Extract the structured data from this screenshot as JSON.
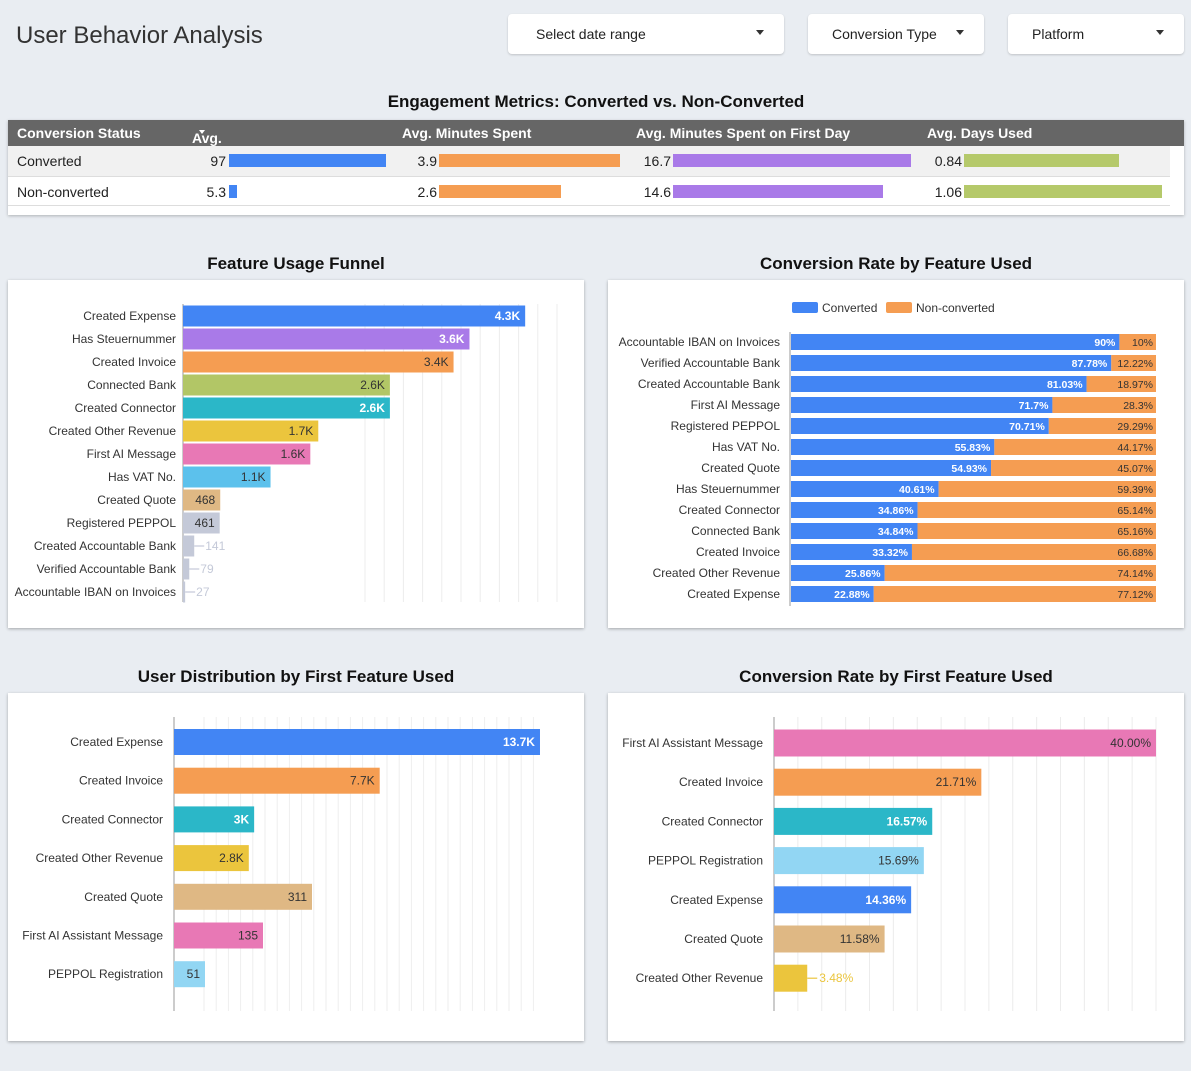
{
  "header": {
    "title": "User Behavior Analysis",
    "filters": {
      "date_range": "Select date range",
      "conversion_type": "Conversion Type",
      "platform": "Platform"
    }
  },
  "engagement": {
    "title": "Engagement Metrics: Converted vs. Non-Converted",
    "columns": [
      "Conversion Status",
      "Avg. Session",
      "Avg. Minutes Spent",
      "Avg. Minutes Spent on First Day",
      "Avg. Days Used"
    ],
    "rows": [
      {
        "status": "Converted",
        "session": "97",
        "minutes": "3.9",
        "first_day": "16.7",
        "days": "0.84"
      },
      {
        "status": "Non-converted",
        "session": "5.3",
        "minutes": "2.6",
        "first_day": "14.6",
        "days": "1.06"
      }
    ],
    "colors": {
      "session": "#4285f4",
      "minutes": "#f59d52",
      "first_day": "#a97ae8",
      "days": "#b5c96a"
    }
  },
  "chart_data": [
    {
      "type": "bar",
      "orientation": "horizontal",
      "title": "Feature Usage Funnel",
      "categories": [
        "Created Expense",
        "Has Steuernummer",
        "Created Invoice",
        "Connected Bank",
        "Created Connector",
        "Created Other Revenue",
        "First AI Message",
        "Has VAT No.",
        "Created Quote",
        "Registered PEPPOL",
        "Created Accountable Bank",
        "Verified Accountable Bank",
        "Accountable IBAN on Invoices"
      ],
      "values": [
        4300,
        3600,
        3400,
        2600,
        2600,
        1700,
        1600,
        1100,
        468,
        461,
        141,
        79,
        27
      ],
      "labels": [
        "4.3K",
        "3.6K",
        "3.4K",
        "2.6K",
        "2.6K",
        "1.7K",
        "1.6K",
        "1.1K",
        "468",
        "461",
        "141",
        "79",
        "27"
      ],
      "colors": [
        "#4285f4",
        "#a97ae8",
        "#f59d52",
        "#b2c666",
        "#2bb7c8",
        "#ebc53d",
        "#e878b5",
        "#5cc1ec",
        "#dfb884",
        "#c4c9d8",
        "#c4c9d8",
        "#c4c9d8",
        "#c4c9d8"
      ],
      "xlim": [
        0,
        4700
      ]
    },
    {
      "type": "bar",
      "orientation": "horizontal",
      "stacked": true,
      "title": "Conversion Rate by Feature Used",
      "legend": "top",
      "categories": [
        "Accountable IBAN on Invoices",
        "Verified Accountable Bank",
        "Created Accountable Bank",
        "First AI Message",
        "Registered PEPPOL",
        "Has VAT No.",
        "Created Quote",
        "Has Steuernummer",
        "Created Connector",
        "Connected Bank",
        "Created Invoice",
        "Created Other Revenue",
        "Created Expense"
      ],
      "series": [
        {
          "name": "Converted",
          "color": "#4285f4",
          "values": [
            90,
            87.78,
            81.03,
            71.7,
            70.71,
            55.83,
            54.93,
            40.61,
            34.86,
            34.84,
            33.32,
            25.86,
            22.88
          ],
          "labels": [
            "90%",
            "87.78%",
            "81.03%",
            "71.7%",
            "70.71%",
            "55.83%",
            "54.93%",
            "40.61%",
            "34.86%",
            "34.84%",
            "33.32%",
            "25.86%",
            "22.88%"
          ]
        },
        {
          "name": "Non-converted",
          "color": "#f59d52",
          "values": [
            10,
            12.22,
            18.97,
            28.3,
            29.29,
            44.17,
            45.07,
            59.39,
            65.14,
            65.16,
            66.68,
            74.14,
            77.12
          ],
          "labels": [
            "10%",
            "12.22%",
            "18.97%",
            "28.3%",
            "29.29%",
            "44.17%",
            "45.07%",
            "59.39%",
            "65.14%",
            "65.16%",
            "66.68%",
            "74.14%",
            "77.12%"
          ]
        }
      ],
      "xlim": [
        0,
        100
      ]
    },
    {
      "type": "bar",
      "orientation": "horizontal",
      "title": "User Distribution by First Feature Used",
      "categories": [
        "Created Expense",
        "Created Invoice",
        "Created Connector",
        "Created Other Revenue",
        "Created Quote",
        "First AI Assistant Message",
        "PEPPOL Registration"
      ],
      "values": [
        13700,
        7700,
        3000,
        2800,
        311,
        135,
        51
      ],
      "labels": [
        "13.7K",
        "7.7K",
        "3K",
        "2.8K",
        "311",
        "135",
        "51"
      ],
      "colors": [
        "#4285f4",
        "#f59d52",
        "#2bb7c8",
        "#ebc53d",
        "#dfb884",
        "#e878b5",
        "#92d6f3"
      ],
      "xlim": [
        0,
        14000
      ]
    },
    {
      "type": "bar",
      "orientation": "horizontal",
      "title": "Conversion Rate by First Feature Used",
      "categories": [
        "First AI Assistant Message",
        "Created Invoice",
        "Created Connector",
        "PEPPOL Registration",
        "Created Expense",
        "Created Quote",
        "Created Other Revenue"
      ],
      "values": [
        40.0,
        21.71,
        16.57,
        15.69,
        14.36,
        11.58,
        3.48
      ],
      "labels": [
        "40.00%",
        "21.71%",
        "16.57%",
        "15.69%",
        "14.36%",
        "11.58%",
        "3.48%"
      ],
      "colors": [
        "#e878b5",
        "#f59d52",
        "#2bb7c8",
        "#92d6f3",
        "#4285f4",
        "#dfb884",
        "#ebc53d"
      ],
      "xlim": [
        0,
        40
      ]
    }
  ]
}
